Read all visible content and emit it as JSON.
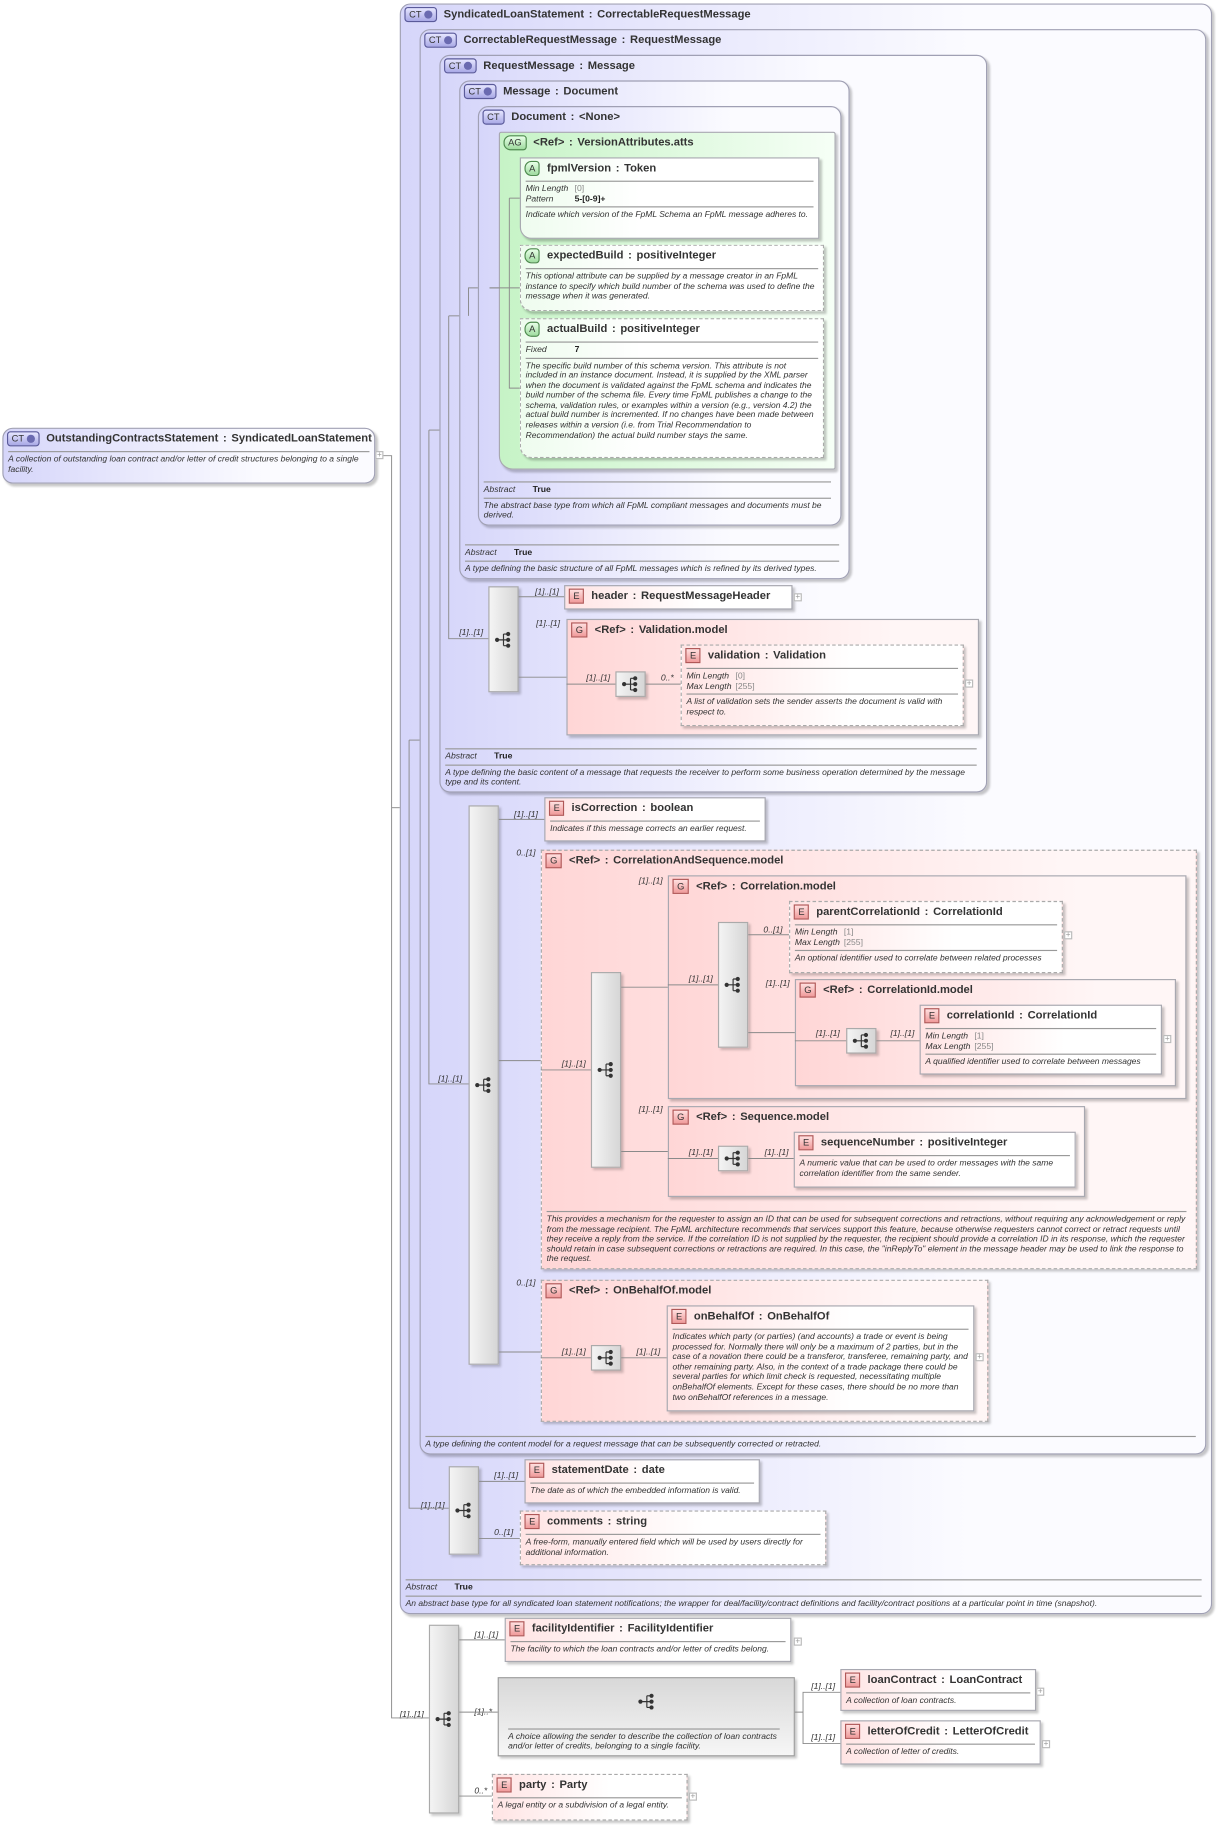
{
  "labels": {
    "sep": ":"
  },
  "nodes": {
    "syndicated": {
      "badge": "CT",
      "ext": true,
      "name": "SyndicatedLoanStatement",
      "type": "CorrectableRequestMessage",
      "abstract": {
        "label": "Abstract",
        "value": "True"
      },
      "desc": "An abstract base type for all syndicated loan statement notifications; the wrapper for deal/facility/contract definitions and facility/contract positions at a particular point in time (snapshot)."
    },
    "correctable": {
      "badge": "CT",
      "ext": true,
      "name": "CorrectableRequestMessage",
      "type": "RequestMessage",
      "desc": "A type defining the content model for a request message that can be subsequently corrected or retracted."
    },
    "requestMessage": {
      "badge": "CT",
      "ext": true,
      "name": "RequestMessage",
      "type": "Message",
      "abstract": {
        "label": "Abstract",
        "value": "True"
      },
      "desc": "A type defining the basic content of a message that requests the receiver to perform some business operation determined by the message type and its content."
    },
    "message": {
      "badge": "CT",
      "ext": true,
      "name": "Message",
      "type": "Document",
      "abstract": {
        "label": "Abstract",
        "value": "True"
      },
      "desc": "A type defining the basic structure of all FpML messages which is refined by its derived types."
    },
    "document": {
      "badge": "CT",
      "name": "Document",
      "type": "<None>",
      "abstract": {
        "label": "Abstract",
        "value": "True"
      },
      "desc": "The abstract base type from which all FpML compliant messages and documents must be derived."
    },
    "versionAtts": {
      "badge": "AG",
      "name": "<Ref>",
      "type": "VersionAttributes.atts"
    },
    "fpmlVersion": {
      "badge": "A",
      "name": "fpmlVersion",
      "type": "Token",
      "props": [
        {
          "k": "Min Length",
          "v": "[0]"
        },
        {
          "k": "Pattern",
          "v": "5-[0-9]+",
          "dark": true
        }
      ],
      "desc": "Indicate which version of the FpML Schema an FpML message adheres to."
    },
    "expectedBuild": {
      "badge": "A",
      "name": "expectedBuild",
      "type": "positiveInteger",
      "desc": "This optional attribute can be supplied by a message creator in an FpML instance to specify which build number of the schema was used to define the message when it was generated."
    },
    "actualBuild": {
      "badge": "A",
      "name": "actualBuild",
      "type": "positiveInteger",
      "props": [
        {
          "k": "Fixed",
          "v": "7",
          "dark": true
        }
      ],
      "desc": "The specific build number of this schema version. This attribute is not included in an instance document. Instead, it is supplied by the XML parser when the document is validated against the FpML schema and indicates the build number of the schema file. Every time FpML publishes a change to the schema, validation rules, or examples within a version (e.g., version 4.2) the actual build number is incremented. If no changes have been made between releases within a version (i.e. from Trial Recommendation to Recommendation) the actual build number stays the same."
    },
    "header": {
      "badge": "E",
      "name": "header",
      "type": "RequestMessageHeader"
    },
    "validationModel": {
      "badge": "G",
      "name": "<Ref>",
      "type": "Validation.model"
    },
    "validation": {
      "badge": "E",
      "name": "validation",
      "type": "Validation",
      "props": [
        {
          "k": "Min Length",
          "v": "[0]"
        },
        {
          "k": "Max Length",
          "v": "[255]"
        }
      ],
      "desc": "A list of validation sets the sender asserts the document is valid with respect to."
    },
    "isCorrection": {
      "badge": "E",
      "name": "isCorrection",
      "type": "boolean",
      "desc": "Indicates if this message corrects an earlier request."
    },
    "casModel": {
      "badge": "G",
      "name": "<Ref>",
      "type": "CorrelationAndSequence.model",
      "desc": "This provides a mechanism for the requester to assign an ID that can be used for subsequent corrections and retractions, without requiring any acknowledgement or reply from the message recipient. The FpML architecture recommends that services support this feature, because otherwise requesters cannot correct or retract requests until they receive a reply from the service. If the correlation ID is not supplied by the requester, the recipient should provide a correlation ID in its response, which the requester should retain in case subsequent corrections or retractions are required. In this case, the \"inReplyTo\" element in the message header may be used to link the response to the request."
    },
    "correlationModel": {
      "badge": "G",
      "name": "<Ref>",
      "type": "Correlation.model"
    },
    "parentCorrelationId": {
      "badge": "E",
      "name": "parentCorrelationId",
      "type": "CorrelationId",
      "props": [
        {
          "k": "Min Length",
          "v": "[1]"
        },
        {
          "k": "Max Length",
          "v": "[255]"
        }
      ],
      "desc": "An optional identifier used to correlate between related processes"
    },
    "correlationIdModel": {
      "badge": "G",
      "name": "<Ref>",
      "type": "CorrelationId.model"
    },
    "correlationId": {
      "badge": "E",
      "name": "correlationId",
      "type": "CorrelationId",
      "props": [
        {
          "k": "Min Length",
          "v": "[1]"
        },
        {
          "k": "Max Length",
          "v": "[255]"
        }
      ],
      "desc": "A qualified identifier used to correlate between messages"
    },
    "sequenceModel": {
      "badge": "G",
      "name": "<Ref>",
      "type": "Sequence.model"
    },
    "sequenceNumber": {
      "badge": "E",
      "name": "sequenceNumber",
      "type": "positiveInteger",
      "desc": "A numeric value that can be used to order messages with the same correlation identifier from the same sender."
    },
    "onBehalfOfModel": {
      "badge": "G",
      "name": "<Ref>",
      "type": "OnBehalfOf.model"
    },
    "onBehalfOf": {
      "badge": "E",
      "name": "onBehalfOf",
      "type": "OnBehalfOf",
      "desc": "Indicates which party (or parties) (and accounts) a trade or event is being processed for. Normally there will only be a maximum of 2 parties, but in the case of a novation there could be a transferor, transferee, remaining party, and other remaining party. Also, in the context of a trade package there could be several parties for which limit check is requested, necessitating multiple onBehalfOf elements. Except for these cases, there should be no more than two onBehalfOf references in a message."
    },
    "statementDate": {
      "badge": "E",
      "name": "statementDate",
      "type": "date",
      "desc": "The date as of which the embedded information is valid."
    },
    "comments": {
      "badge": "E",
      "name": "comments",
      "type": "string",
      "desc": "A free-form, manually entered field which will be used by users directly for additional information."
    },
    "outstanding": {
      "badge": "CT",
      "ext": true,
      "name": "OutstandingContractsStatement",
      "type": "SyndicatedLoanStatement",
      "desc": "A collection of outstanding loan contract and/or letter of credit structures belonging to a single facility."
    },
    "facilityIdentifier": {
      "badge": "E",
      "name": "facilityIdentifier",
      "type": "FacilityIdentifier",
      "desc": "The facility to which the loan contracts and/or letter of credits belong."
    },
    "choice": {
      "desc": "A choice allowing the sender to describe the collection of loan contracts and/or letter of credits, belonging to a single facility."
    },
    "loanContract": {
      "badge": "E",
      "name": "loanContract",
      "type": "LoanContract",
      "desc": "A collection of loan contracts."
    },
    "letterOfCredit": {
      "badge": "E",
      "name": "letterOfCredit",
      "type": "LetterOfCredit",
      "desc": "A collection of letter of credits."
    },
    "party": {
      "badge": "E",
      "name": "party",
      "type": "Party",
      "desc": "A legal entity or a subdivision of a legal entity."
    }
  },
  "cardinalities": [
    "[1]..[1]",
    "[1]..[1]",
    "[1]..[1]",
    "[1]..[1]",
    "0..*",
    "[1]..[1]",
    "0..[1]",
    "[1]..[1]",
    "0..[1]",
    "[1]..[1]",
    "[1]..[1]",
    "[1]..[1]",
    "[1]..[1]",
    "[1]..[1]",
    "[1]..[1]",
    "[1]..[1]",
    "[1]..[1]",
    "[1]..[1]",
    "0..[1]",
    "[1]..[1]",
    "[1]..[1]",
    "[1]..[1]",
    "[1]..[1]",
    "0..[1]",
    "[1]..[1]",
    "[1]..[1]",
    "[1]..*",
    "[1]..[1]",
    "[1]..[1]",
    "0..*"
  ]
}
